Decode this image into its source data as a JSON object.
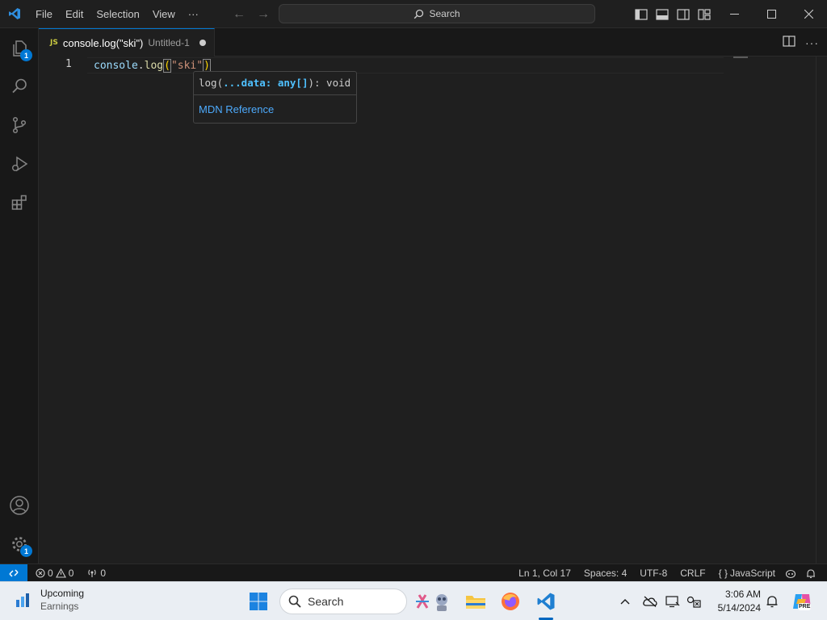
{
  "titlebar": {
    "menu": [
      "File",
      "Edit",
      "Selection",
      "View",
      "···"
    ],
    "search_label": "Search"
  },
  "tab": {
    "lang_label": "JS",
    "title": "console.log(\"ski\")",
    "description": "Untitled-1"
  },
  "editor": {
    "line_number": "1",
    "code": {
      "obj": "console",
      "dot": ".",
      "fn": "log",
      "open_paren": "(",
      "string": "\"ski\"",
      "close_paren": ")"
    }
  },
  "hover": {
    "sig_prefix": "log(",
    "sig_param": "...data: any[]",
    "sig_suffix": "): void",
    "link": "MDN Reference"
  },
  "activity_badges": {
    "explorer": "1",
    "settings": "1"
  },
  "statusbar": {
    "errors": "0",
    "warnings": "0",
    "ports": "0",
    "position": "Ln 1, Col 17",
    "spaces": "Spaces: 4",
    "encoding": "UTF-8",
    "eol": "CRLF",
    "language_braces": "{ }",
    "language": "JavaScript"
  },
  "taskbar": {
    "weather_title": "Upcoming",
    "weather_sub": "Earnings",
    "search_label": "Search",
    "time": "3:06 AM",
    "date": "5/14/2024",
    "copilot_badge": "PRE"
  },
  "colors": {
    "accent": "#0078d4",
    "editor_bg": "#1f1f1f",
    "sidebar_bg": "#181818",
    "link": "#4daafc"
  }
}
